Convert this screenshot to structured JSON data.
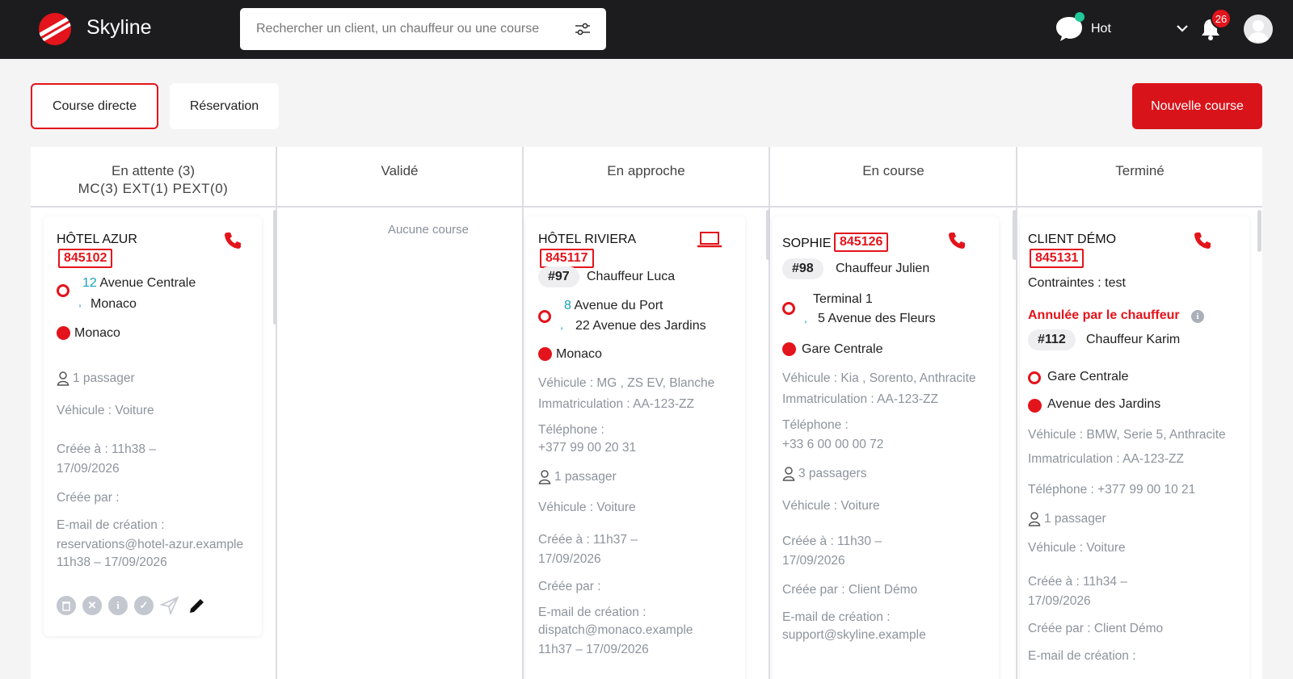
{
  "header": {
    "brand": "Skyline",
    "search_placeholder": "Rechercher un client, un chauffeur ou une course",
    "status_label": "Hot",
    "notif_count": "26"
  },
  "tabs": {
    "direct": "Course directe",
    "reservation": "Réservation"
  },
  "actions": {
    "new_course": "Nouvelle course"
  },
  "columns": {
    "waiting": {
      "title": "En attente (3)",
      "sub": "MC(3) EXT(1) PEXT(0)"
    },
    "validated": {
      "title": "Validé",
      "empty": "Aucune course"
    },
    "approaching": {
      "title": "En approche"
    },
    "in_progress": {
      "title": "En course"
    },
    "done": {
      "title": "Terminé"
    }
  },
  "cards": {
    "c1": {
      "client": "HÔTEL AZUR",
      "code": "845102",
      "pickup_num": "12",
      "pickup_street": "Avenue Centrale",
      "pickup_city": "Monaco",
      "dropoff": "Monaco",
      "passengers": "1 passager",
      "vehicle_type": "Véhicule : Voiture",
      "created_at": "Créée à : 11h38 –",
      "created_date": "17/09/2026",
      "created_by": "Créée par :",
      "email_label": "E-mail de création :",
      "email": "reservations@hotel-azur.example",
      "email_time": "11h38 – 17/09/2026"
    },
    "c2": {
      "client": "HÔTEL RIVIERA",
      "code": "845117",
      "driver_num": "#97",
      "driver": "Chauffeur Luca",
      "pickup_num": "8",
      "pickup_street": "Avenue du Port",
      "pickup_extra": "22 Avenue des Jardins",
      "dropoff": "Monaco",
      "vehicle": "Véhicule : MG , ZS EV, Blanche",
      "plate": "Immatriculation : AA-123-ZZ",
      "phone_label": "Téléphone :",
      "phone": "+377 99 00 20 31",
      "passengers": "1 passager",
      "vehicle_type": "Véhicule : Voiture",
      "created_at": "Créée à : 11h37 –",
      "created_date": "17/09/2026",
      "created_by": "Créée par :",
      "email_label": "E-mail de création :",
      "email": "dispatch@monaco.example",
      "email_time": "11h37 – 17/09/2026"
    },
    "c3": {
      "client": "SOPHIE",
      "code": "845126",
      "driver_num": "#98",
      "driver": "Chauffeur Julien",
      "pickup_line1": "Terminal 1",
      "pickup_line2": "5 Avenue des Fleurs",
      "dropoff": "Gare Centrale",
      "vehicle": "Véhicule : Kia , Sorento, Anthracite",
      "plate": "Immatriculation : AA-123-ZZ",
      "phone_label": "Téléphone :",
      "phone": "+33 6 00 00 00 72",
      "passengers": "3 passagers",
      "vehicle_type": "Véhicule : Voiture",
      "created_at": "Créée à : 11h30 –",
      "created_date": "17/09/2026",
      "created_by": "Créée par : Client Démo",
      "email_label": "E-mail de création :",
      "email": "support@skyline.example"
    },
    "c4": {
      "client": "CLIENT DÉMO",
      "code": "845131",
      "constraints": "Contraintes : test",
      "cancelled": "Annulée par le chauffeur",
      "driver_num": "#112",
      "driver": "Chauffeur Karim",
      "pickup": "Gare Centrale",
      "dropoff": "Avenue des Jardins",
      "vehicle": "Véhicule : BMW, Serie 5, Anthracite",
      "plate": "Immatriculation : AA-123-ZZ",
      "phone": "Téléphone : +377 99 00 10 21",
      "passengers": "1 passager",
      "vehicle_type": "Véhicule : Voiture",
      "created_at": "Créée à : 11h34 –",
      "created_date": "17/09/2026",
      "created_by": "Créée par : Client Démo",
      "email_label": "E-mail de création :"
    }
  },
  "colors": {
    "accent": "#e3141b",
    "dark": "#1c1c1e",
    "teal": "#17a2b8",
    "muted": "#8d939c"
  }
}
